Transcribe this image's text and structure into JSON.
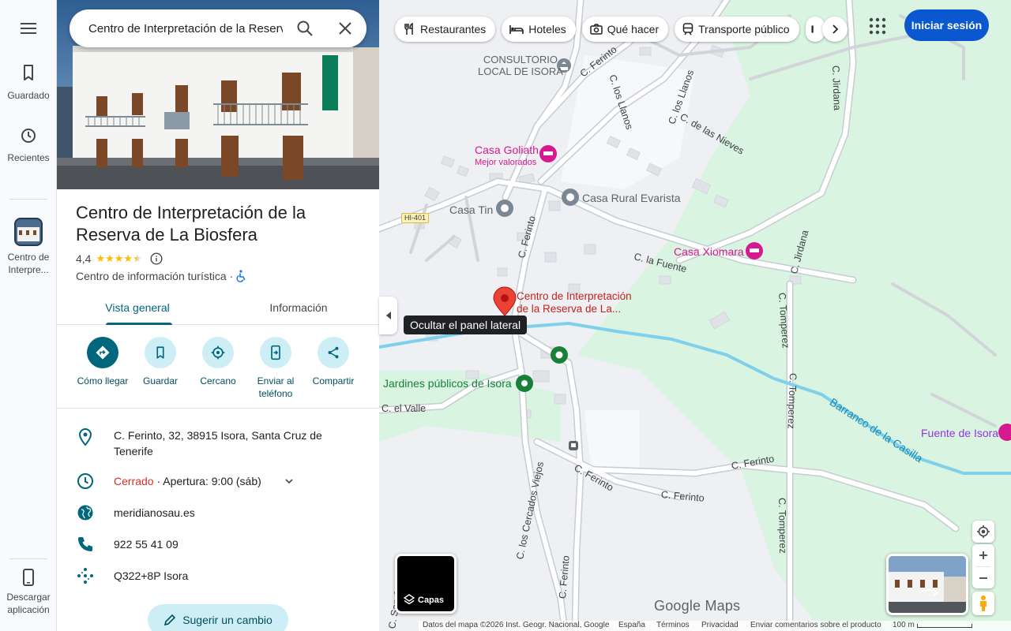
{
  "rail": {
    "menu_icon": "hamburger-menu-icon",
    "saved_label": "Guardado",
    "recent_label": "Recientes",
    "place_label": "Centro de Interpre...",
    "download_label": "Descargar aplicación"
  },
  "search": {
    "value": "Centro de Interpretación de la Reserva de La Biosfera"
  },
  "place": {
    "title": "Centro de Interpretación de la Reserva de La Biosfera",
    "rating": "4,4",
    "stars": 4.4,
    "category": "Centro de información turística",
    "separator": "·"
  },
  "tabs": [
    {
      "label": "Vista general"
    },
    {
      "label": "Información"
    }
  ],
  "actions": [
    {
      "label": "Cómo llegar",
      "icon": "directions-icon"
    },
    {
      "label": "Guardar",
      "icon": "bookmark-icon"
    },
    {
      "label": "Cercano",
      "icon": "nearby-icon"
    },
    {
      "label": "Enviar al teléfono",
      "icon": "send-to-phone-icon"
    },
    {
      "label": "Compartir",
      "icon": "share-icon"
    }
  ],
  "details": {
    "address": "C. Ferinto, 32, 38915 Isora, Santa Cruz de Tenerife",
    "hours_status": "Cerrado",
    "hours_text": " · Apertura: 9:00 (sáb)",
    "website": "meridianosau.es",
    "phone": "922 55 41 09",
    "plus_code": "Q322+8P Isora"
  },
  "suggest_label": "Sugerir un cambio",
  "tooltip": "Ocultar el panel lateral",
  "chips": [
    {
      "label": "Restaurantes",
      "icon": "restaurant-icon"
    },
    {
      "label": "Hoteles",
      "icon": "hotel-icon"
    },
    {
      "label": "Qué hacer",
      "icon": "camera-icon"
    },
    {
      "label": "Transporte público",
      "icon": "transit-icon"
    }
  ],
  "signin_label": "Iniciar sesión",
  "map": {
    "places": {
      "consultorio": "CONSULTORIO\nLOCAL DE ISORA",
      "casa_goliath": "Casa Goliath",
      "casa_goliath_sub": "Mejor valorados",
      "casa_rural": "Casa Rural Evarista",
      "casa_tin": "Casa Tin",
      "casa_xiomara": "Casa Xiomara",
      "selected_1": "Centro de Interpretación",
      "selected_2": "de la Reserva de La...",
      "jardines": "Jardines públicos de Isora",
      "fuente": "Fuente de Isora"
    },
    "streets": {
      "ferinto": "C. Ferinto",
      "los_llanos": "C. los Llanos",
      "las_nieves": "C. de las Nieves",
      "la_fuente": "C. la Fuente",
      "el_valle": "C. el Valle",
      "jirdana": "C. Jirdana",
      "tomperez": "C. Tomperez",
      "cercados_viejos": "C. los Cercados Viejos",
      "san_jose": "C. San José"
    },
    "river": "Barranco de la Casilla",
    "highway": "HI-401",
    "layers_label": "Capas",
    "logo": "Google Maps"
  },
  "footer": {
    "data": "Datos del mapa ©2026 Inst. Geogr. Nacional, Google",
    "country": "España",
    "terms": "Términos",
    "privacy": "Privacidad",
    "feedback": "Enviar comentarios sobre el producto",
    "scale": "100 m"
  },
  "colors": {
    "accent": "#00677d",
    "signin": "#0b57d0",
    "closed": "#d93025",
    "pin": "#ea4335",
    "river": "#5bc3e6",
    "park": "#d9f4e0"
  }
}
